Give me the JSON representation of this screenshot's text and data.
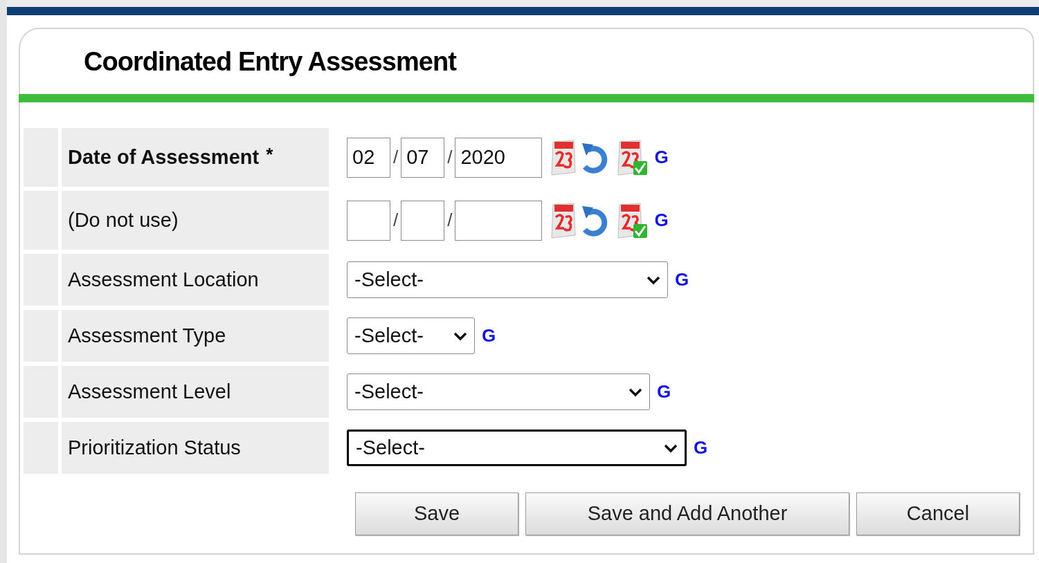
{
  "form": {
    "title": "Coordinated Entry Assessment"
  },
  "fields": [
    {
      "kind": "date",
      "label": "Date of Assessment",
      "required": true,
      "month": "02",
      "day": "07",
      "year": "2020",
      "separator": "/",
      "link": "G"
    },
    {
      "kind": "date",
      "label": "(Do not use)",
      "required": false,
      "separator": "/",
      "link": "G"
    },
    {
      "kind": "select",
      "label": "Assessment Location",
      "value": "-Select-",
      "focused": false,
      "link": "G"
    },
    {
      "kind": "select",
      "label": "Assessment Type",
      "value": "-Select-",
      "focused": false,
      "link": "G"
    },
    {
      "kind": "select",
      "label": "Assessment Level",
      "value": "-Select-",
      "focused": false,
      "link": "G"
    },
    {
      "kind": "select",
      "label": "Prioritization Status",
      "value": "-Select-",
      "focused": true,
      "link": "G"
    }
  ],
  "buttons": [
    "Save",
    "Save and Add Another",
    "Cancel"
  ],
  "required_mark": "*"
}
